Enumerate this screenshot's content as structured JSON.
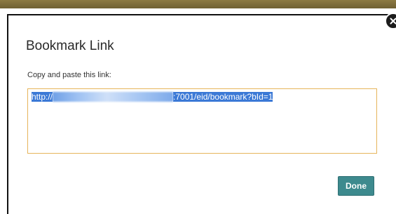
{
  "dialog": {
    "title": "Bookmark Link",
    "instruction": "Copy and paste this link:",
    "link": {
      "prefix": "http://",
      "suffix": ":7001/eid/bookmark?bId=1"
    },
    "done_label": "Done"
  },
  "colors": {
    "top_band": "#7d6c3b",
    "field_border": "#e6b45a",
    "selection": "#3b79d6",
    "done_button": "#3d8a8e"
  },
  "icons": {
    "close": "close-icon"
  }
}
